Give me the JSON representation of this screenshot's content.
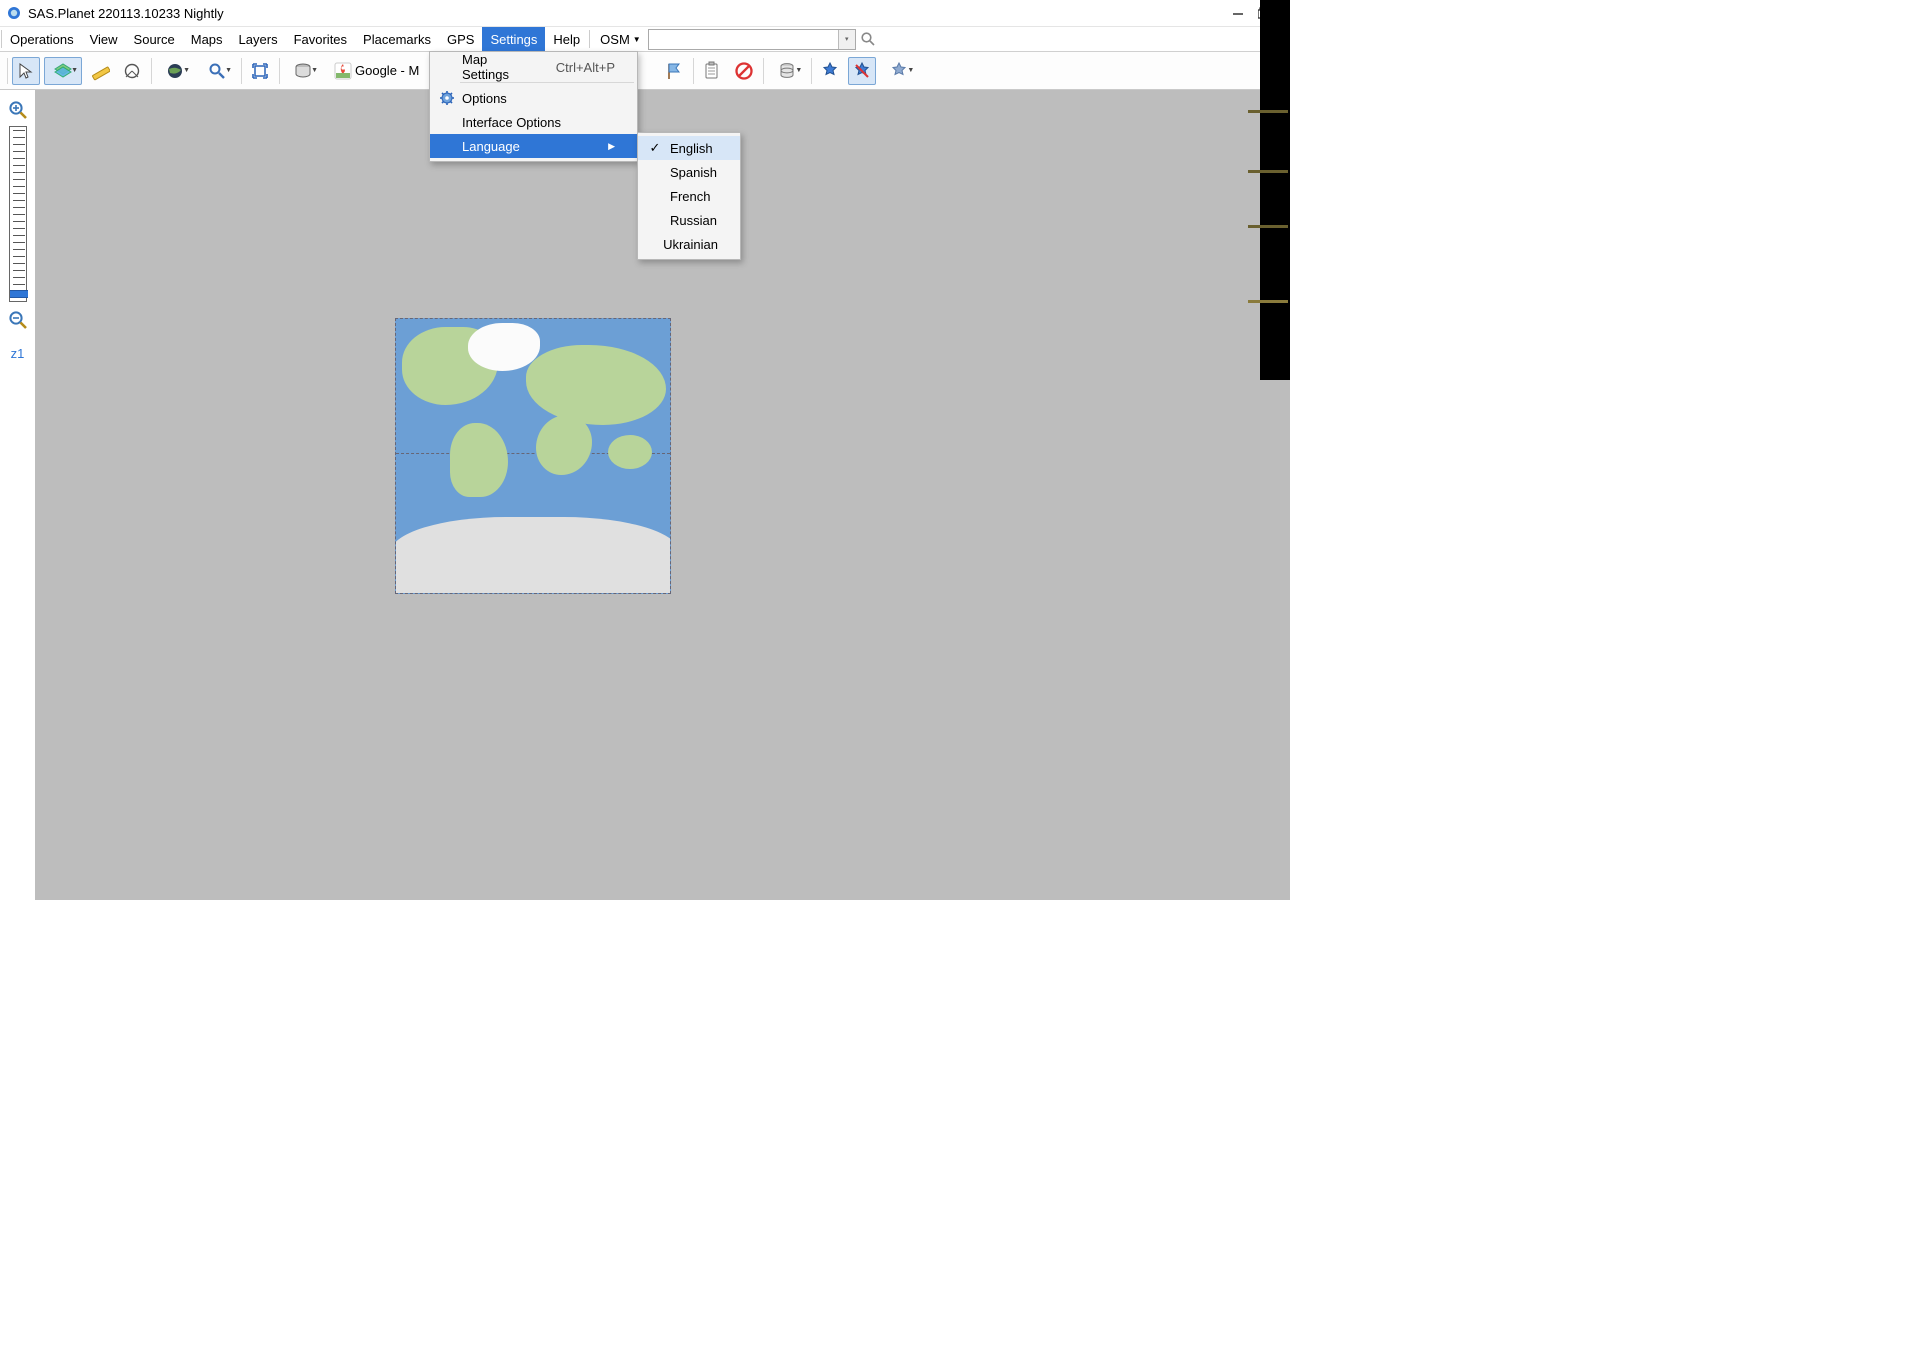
{
  "title": "SAS.Planet 220113.10233 Nightly",
  "menubar": {
    "operations": "Operations",
    "view": "View",
    "source": "Source",
    "maps": "Maps",
    "layers": "Layers",
    "favorites": "Favorites",
    "placemarks": "Placemarks",
    "gps": "GPS",
    "settings": "Settings",
    "help": "Help"
  },
  "osm": {
    "label": "OSM"
  },
  "toolbar": {
    "maplabel": "Google - M"
  },
  "settings_menu": {
    "map_settings": "Map Settings",
    "map_settings_accel": "Ctrl+Alt+P",
    "options": "Options",
    "interface_options": "Interface Options",
    "language": "Language"
  },
  "language_menu": {
    "english": "English",
    "spanish": "Spanish",
    "french": "French",
    "russian": "Russian",
    "ukrainian": "Ukrainian"
  },
  "zoom": {
    "label": "z1"
  }
}
